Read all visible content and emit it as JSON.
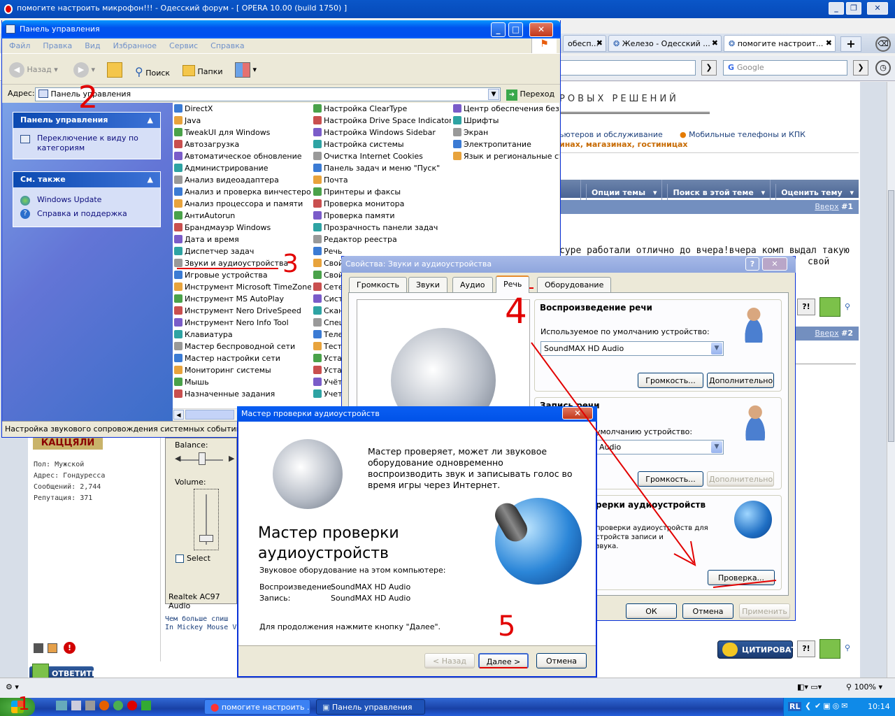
{
  "opera": {
    "title": "помогите настроить микрофон!!! - Одесский форум - [ OPERA 10.00 (build 1750) ]",
    "tabs": [
      "обесп...",
      "Железо - Одесский ...",
      "помогите настроит..."
    ],
    "search_placeholder": "Google",
    "banner": "РОВЫХ РЕШЕНИЙ",
    "link1": "ьютеров и обслуживание",
    "link2": "Мобильные телефоны и КПК",
    "link3": "инах, магазинах, гостиницах",
    "nav": [
      "Опции темы",
      "Поиск в этой теме",
      "Оценить тему"
    ],
    "post1_up": "Вверх",
    "post1_num": "#1",
    "post2_up": "Вверх",
    "post2_num": "#2",
    "post_text_1": "суре работали отлично до вчера!вчера комп выдал такую",
    "post_text_2": "свой",
    "user_logo": "КАЦЦЯЛИ",
    "user_info": [
      "Пол: Мужской",
      "Адрес: Гондуресса",
      "Сообщений: 2,744",
      "Репутация: 371"
    ],
    "sig1": "Чем больше спиш",
    "sig2": "In Mickey Mouse V",
    "quote_btn": "ЦИТИРОВАТЬ",
    "reply_btn": "ОТВЕТИТЬ",
    "zoom": "100%"
  },
  "mixer": {
    "balance": "Balance:",
    "volume": "Volume:",
    "select": "Select",
    "device": "Realtek AC97 Audio"
  },
  "cp": {
    "title": "Панель управления",
    "menu": [
      "Файл",
      "Правка",
      "Вид",
      "Избранное",
      "Сервис",
      "Справка"
    ],
    "back": "Назад",
    "search": "Поиск",
    "folders": "Папки",
    "addr_label": "Адрес:",
    "addr": "Панель управления",
    "go": "Переход",
    "side1_head": "Панель управления",
    "side1_item": "Переключение к виду по категориям",
    "side2_head": "См. также",
    "side2_items": [
      "Windows Update",
      "Справка и поддержка"
    ],
    "col1": [
      "DirectX",
      "Java",
      "TweakUI для Windows",
      "Автозагрузка",
      "Автоматическое обновление",
      "Администрирование",
      "Анализ видеоадаптера",
      "Анализ и проверка винчестеров",
      "Анализ процессора и памяти",
      "АнтиAutorun",
      "Брандмауэр Windows",
      "Дата и время",
      "Диспетчер задач",
      "Звуки и аудиоустройства",
      "Игровые устройства",
      "Инструмент Microsoft TimeZone",
      "Инструмент MS AutoPlay",
      "Инструмент Nero DriveSpeed",
      "Инструмент Nero Info Tool",
      "Клавиатура",
      "Мастер беспроводной сети",
      "Мастер настройки сети",
      "Мониторинг системы",
      "Мышь",
      "Назначенные задания"
    ],
    "col2": [
      "Настройка ClearType",
      "Настройка Drive Space Indicator",
      "Настройка Windows Sidebar",
      "Настройка системы",
      "Очистка Internet Cookies",
      "Панель задач и меню \"Пуск\"",
      "Почта",
      "Принтеры и факсы",
      "Проверка монитора",
      "Проверка памяти",
      "Прозрачность панели задач",
      "Редактор реестра",
      "Речь",
      "Свой",
      "Свой",
      "Сете",
      "Сист",
      "Скан",
      "Спец",
      "Теле",
      "Тест",
      "Уста",
      "Уста",
      "Учёт",
      "Учет"
    ],
    "col3": [
      "Центр обеспечения безопасности",
      "Шрифты",
      "Экран",
      "Электропитание",
      "Язык и региональные стандарты"
    ],
    "status": "Настройка звукового сопровождения системных событий, или на"
  },
  "props": {
    "title": "Свойства: Звуки и аудиоустройства",
    "tabs": [
      "Громкость",
      "Звуки",
      "Аудио",
      "Речь",
      "Оборудование"
    ],
    "play_head": "Воспроизведение речи",
    "play_label": "Используемое по умолчанию устройство:",
    "play_dev": "SoundMAX HD Audio",
    "vol_btn": "Громкость...",
    "adv_btn": "Дополнительно...",
    "rec_head": "Запись речи",
    "rec_label": "умолчанию устройство:",
    "rec_dev": "Audio",
    "vol_btn2": "Громкость...",
    "adv_btn2": "Дополнительно...",
    "test_head": "рерки аудиоустройств",
    "test_text": [
      "проверки аудиоустройств для",
      "стройств записи и",
      "звука."
    ],
    "test_btn": "Проверка...",
    "ok": "ОК",
    "cancel": "Отмена",
    "apply": "Применить"
  },
  "wizard": {
    "title": "Мастер проверки аудиоустройств",
    "intro": "Мастер проверяет, может ли звуковое оборудование одновременно воспроизводить звук и записывать голос во время игры через Интернет.",
    "heading1": "Мастер проверки",
    "heading2": "аудиоустройств",
    "hw_label": "Звуковое оборудование на этом компьютере:",
    "play_label": "Воспроизведение:",
    "play_val": "SoundMAX HD Audio",
    "rec_label": "Запись:",
    "rec_val": "SoundMAX HD Audio",
    "continue": "Для продолжения нажмите кнопку \"Далее\".",
    "back": "< Назад",
    "next": "Далее >",
    "cancel": "Отмена"
  },
  "taskbar": {
    "tasks": [
      "помогите настроить ...",
      "Панель управления"
    ],
    "tray_lang": "RL",
    "time": "10:14"
  },
  "annotations": [
    "2",
    "3",
    "4",
    "5",
    "1"
  ],
  "colors": {
    "xp_blue": "#0053ee",
    "annotation": "#e20000"
  }
}
